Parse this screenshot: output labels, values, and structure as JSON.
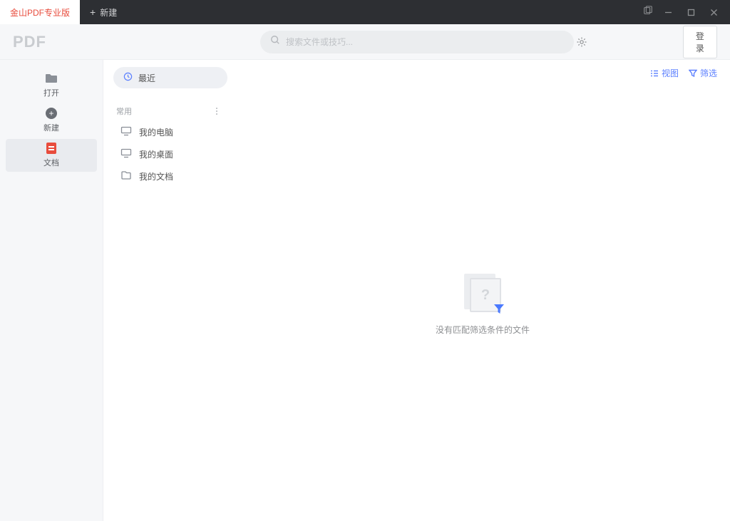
{
  "titlebar": {
    "active_tab": "金山PDF专业版",
    "new_tab": "新建"
  },
  "toolbar": {
    "logo": "PDF",
    "search_placeholder": "搜索文件或技巧...",
    "login": "登录"
  },
  "sidebar": {
    "items": [
      {
        "label": "打开"
      },
      {
        "label": "新建"
      },
      {
        "label": "文档"
      }
    ]
  },
  "panel": {
    "recent": "最近",
    "common_label": "常用",
    "items": [
      {
        "label": "我的电脑"
      },
      {
        "label": "我的桌面"
      },
      {
        "label": "我的文档"
      }
    ]
  },
  "main": {
    "view_label": "视图",
    "filter_label": "筛选",
    "empty_text": "没有匹配筛选条件的文件"
  }
}
